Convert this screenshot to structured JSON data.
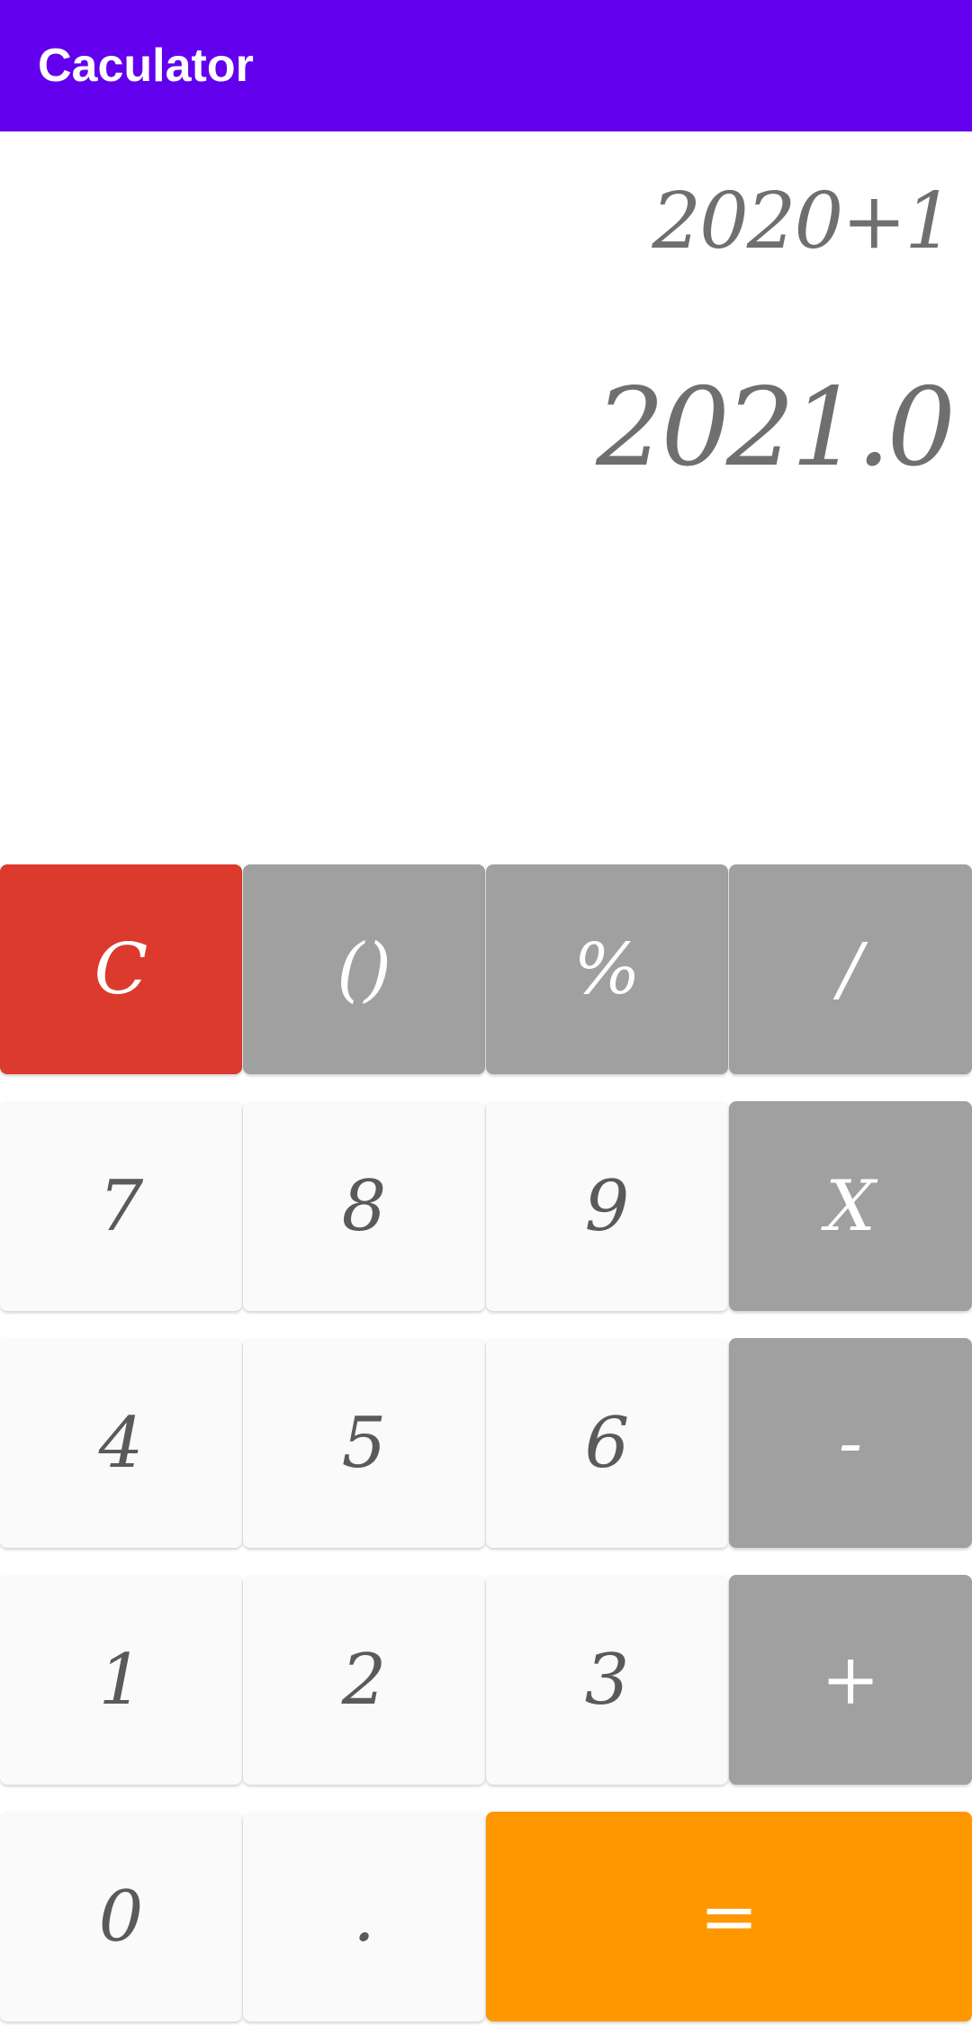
{
  "app_bar": {
    "title": "Caculator",
    "color": "#6200ee"
  },
  "display": {
    "expression": "2020+1",
    "result": "2021.0"
  },
  "keypad": {
    "row1": [
      "C",
      "()",
      "%",
      "/"
    ],
    "row2": [
      "7",
      "8",
      "9",
      "X"
    ],
    "row3": [
      "4",
      "5",
      "6",
      "-"
    ],
    "row4": [
      "1",
      "2",
      "3",
      "+"
    ],
    "row5": [
      "0",
      ".",
      "="
    ]
  },
  "colors": {
    "clear_key": "#dc3a2d",
    "operator_key": "#a0a0a0",
    "digit_key": "#fafafa",
    "equals_key": "#ff9800",
    "display_text": "#6f6f6f"
  }
}
